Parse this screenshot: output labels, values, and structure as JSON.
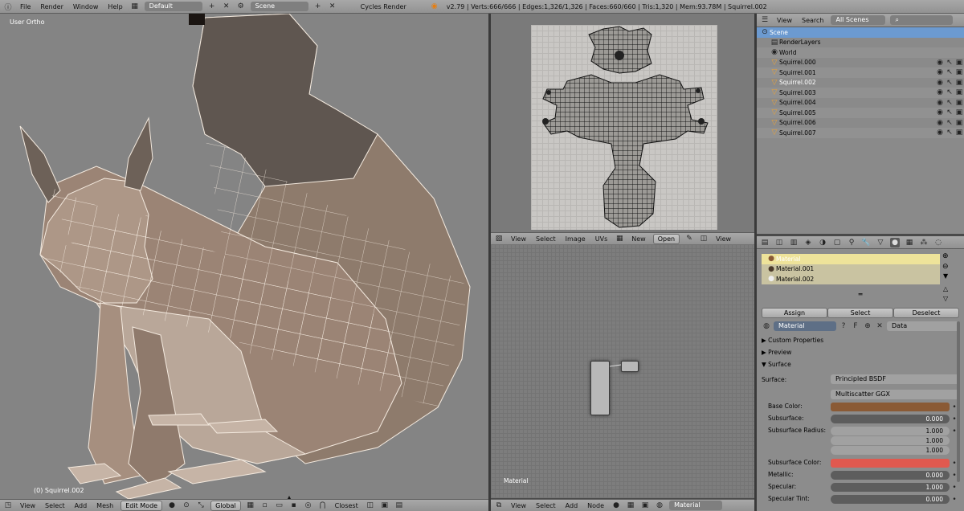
{
  "topbar": {
    "menus": [
      "File",
      "Render",
      "Window",
      "Help"
    ],
    "screen_layout": "Default",
    "scene": "Scene",
    "engine": "Cycles Render",
    "stats": "v2.79 | Verts:666/666 | Edges:1,326/1,326 | Faces:660/660 | Tris:1,320 | Mem:93.78M | Squirrel.002"
  },
  "viewport": {
    "view_label": "User Ortho",
    "object_label": "(0) Squirrel.002",
    "menus": [
      "View",
      "Select",
      "Add",
      "Mesh"
    ],
    "mode": "Edit Mode",
    "orientation": "Global",
    "snap": "Closest"
  },
  "uv_editor": {
    "menus": [
      "View",
      "Select",
      "Image",
      "UVs"
    ],
    "new": "New",
    "open": "Open",
    "view": "View"
  },
  "node_editor": {
    "label": "Material",
    "menus": [
      "View",
      "Select",
      "Add",
      "Node"
    ],
    "material": "Material"
  },
  "outliner": {
    "menus": [
      "View",
      "Search"
    ],
    "filter": "All Scenes",
    "rows": [
      {
        "label": "Scene",
        "indent": 0,
        "selected": true
      },
      {
        "label": "RenderLayers",
        "indent": 1
      },
      {
        "label": "World",
        "indent": 1
      },
      {
        "label": "Squirrel.000",
        "indent": 1
      },
      {
        "label": "Squirrel.001",
        "indent": 1
      },
      {
        "label": "Squirrel.002",
        "indent": 1,
        "active": true
      },
      {
        "label": "Squirrel.003",
        "indent": 1
      },
      {
        "label": "Squirrel.004",
        "indent": 1
      },
      {
        "label": "Squirrel.005",
        "indent": 1
      },
      {
        "label": "Squirrel.006",
        "indent": 1
      },
      {
        "label": "Squirrel.007",
        "indent": 1
      }
    ]
  },
  "properties": {
    "slots": [
      "Material",
      "Material.001",
      "Material.002"
    ],
    "assign": "Assign",
    "select": "Select",
    "deselect": "Deselect",
    "material_name": "Material",
    "users": "F",
    "data": "Data",
    "panels": [
      "Custom Properties",
      "Preview",
      "Surface"
    ],
    "surface_label": "Surface:",
    "surface_value": "Principled BSDF",
    "distribution": "Multiscatter GGX",
    "fields": [
      {
        "label": "Base Color:",
        "type": "color",
        "color": "#8a5a35"
      },
      {
        "label": "Subsurface:",
        "type": "value",
        "value": "0.000"
      },
      {
        "label": "Subsurface Radius:",
        "type": "vec",
        "values": [
          "1.000",
          "1.000",
          "1.000"
        ]
      },
      {
        "label": "Subsurface Color:",
        "type": "color",
        "color": "#e0594f"
      },
      {
        "label": "Metallic:",
        "type": "value",
        "value": "0.000"
      },
      {
        "label": "Specular:",
        "type": "value",
        "value": "1.000"
      },
      {
        "label": "Specular Tint:",
        "type": "value",
        "value": "0.000"
      }
    ]
  }
}
